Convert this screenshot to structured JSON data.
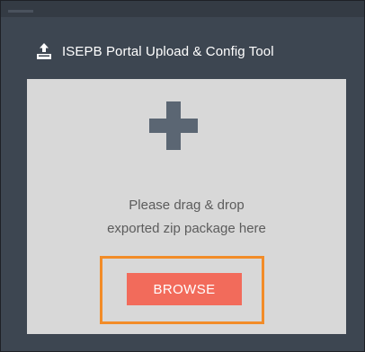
{
  "header": {
    "title": "ISEPB Portal Upload & Config Tool",
    "icon": "upload-tray-icon"
  },
  "dropzone": {
    "icon": "plus-icon",
    "text_line1": "Please drag & drop",
    "text_line2": "exported zip package here",
    "browse_label": "BROWSE"
  },
  "colors": {
    "panel_background": "#3d4651",
    "dropzone_background": "#d8d8d8",
    "plus_icon": "#5b6673",
    "browse_button": "#f26b5b",
    "highlight_border": "#f28c28",
    "title_text": "#ffffff",
    "drop_text": "#5c5c5c"
  }
}
